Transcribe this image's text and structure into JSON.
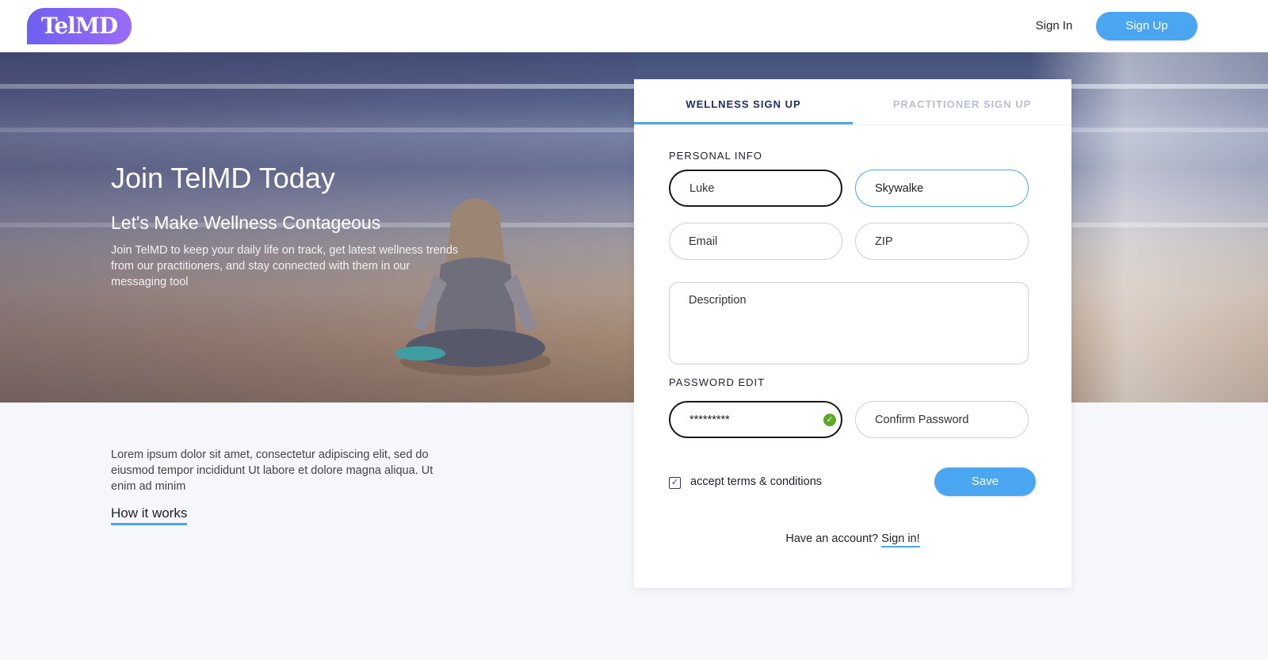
{
  "brand": {
    "logo_text": "TelMD"
  },
  "nav": {
    "sign_in": "Sign In",
    "sign_up": "Sign Up"
  },
  "hero": {
    "title": "Join TelMD Today",
    "subtitle": "Let's Make Wellness Contageous",
    "description": "Join TelMD to keep your daily life on track, get latest wellness trends from our practitioners, and stay connected with them in our messaging tool"
  },
  "intro": {
    "text": "Lorem ipsum dolor sit amet, consectetur  adipiscing elit, sed do eiusmod tempor incididunt Ut labore et dolore magna aliqua. Ut enim ad minim",
    "how_it_works": "How it works"
  },
  "form": {
    "tabs": [
      {
        "label": "WELLNESS SIGN UP",
        "active": true
      },
      {
        "label": "PRACTITIONER SIGN UP",
        "active": false
      }
    ],
    "personal_info_label": "PERSONAL INFO",
    "first_name": {
      "value": "",
      "placeholder": "Luke"
    },
    "last_name": {
      "value": "Skywalke",
      "placeholder": ""
    },
    "email": {
      "value": "",
      "placeholder": "Email"
    },
    "zip": {
      "value": "",
      "placeholder": "ZIP"
    },
    "description": {
      "value": "",
      "placeholder": "Description"
    },
    "password_label": "PASSWORD EDIT",
    "password": {
      "value": "*********",
      "valid": true
    },
    "confirm_password": {
      "value": "",
      "placeholder": "Confirm Password"
    },
    "terms_label": "accept terms & conditions",
    "terms_checked": true,
    "save_label": "Save",
    "have_account": "Have an account?",
    "sign_in_link": "Sign in!"
  },
  "colors": {
    "accent": "#4aa6f0",
    "brand_gradient_start": "#6f5ff0",
    "brand_gradient_end": "#9a6cf6",
    "tab_active": "#1f2f63",
    "tab_inactive": "#b7bfd6",
    "valid_green": "#5aa826",
    "page_bg": "#f6f7fb"
  },
  "icons": {
    "password_valid": "check-circle-icon",
    "terms_checkbox": "checkmark-icon"
  }
}
